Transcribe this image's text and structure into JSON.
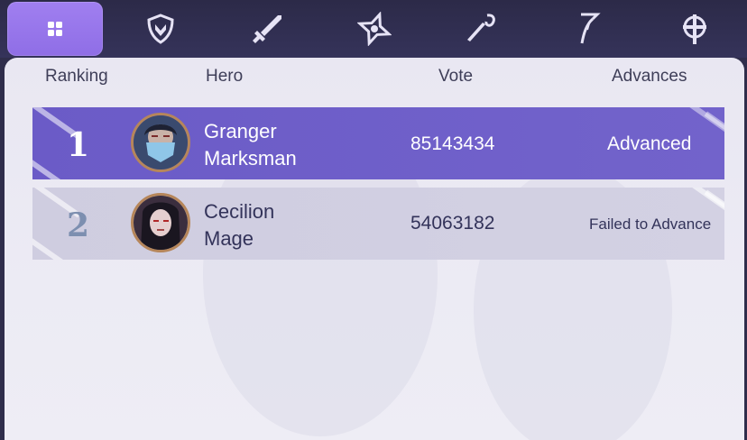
{
  "tabs": [
    {
      "name": "all",
      "icon": "grid-icon"
    },
    {
      "name": "tank",
      "icon": "shield-icon"
    },
    {
      "name": "fighter",
      "icon": "sword-icon"
    },
    {
      "name": "assassin",
      "icon": "shuriken-icon"
    },
    {
      "name": "mage",
      "icon": "wand-icon"
    },
    {
      "name": "marksman",
      "icon": "bow-icon"
    },
    {
      "name": "support",
      "icon": "cross-icon"
    }
  ],
  "table": {
    "headers": {
      "ranking": "Ranking",
      "hero": "Hero",
      "vote": "Vote",
      "advances": "Advances"
    },
    "rows": [
      {
        "rank": "1",
        "hero_name": "Granger",
        "hero_role": "Marksman",
        "vote": "85143434",
        "status": "Advanced"
      },
      {
        "rank": "2",
        "hero_name": "Cecilion",
        "hero_role": "Mage",
        "vote": "54063182",
        "status": "Failed to Advance"
      }
    ]
  },
  "colors": {
    "active_tab": "#9b7aee",
    "advanced_row": "#6b5bc7",
    "failed_row": "#cfcde0"
  }
}
